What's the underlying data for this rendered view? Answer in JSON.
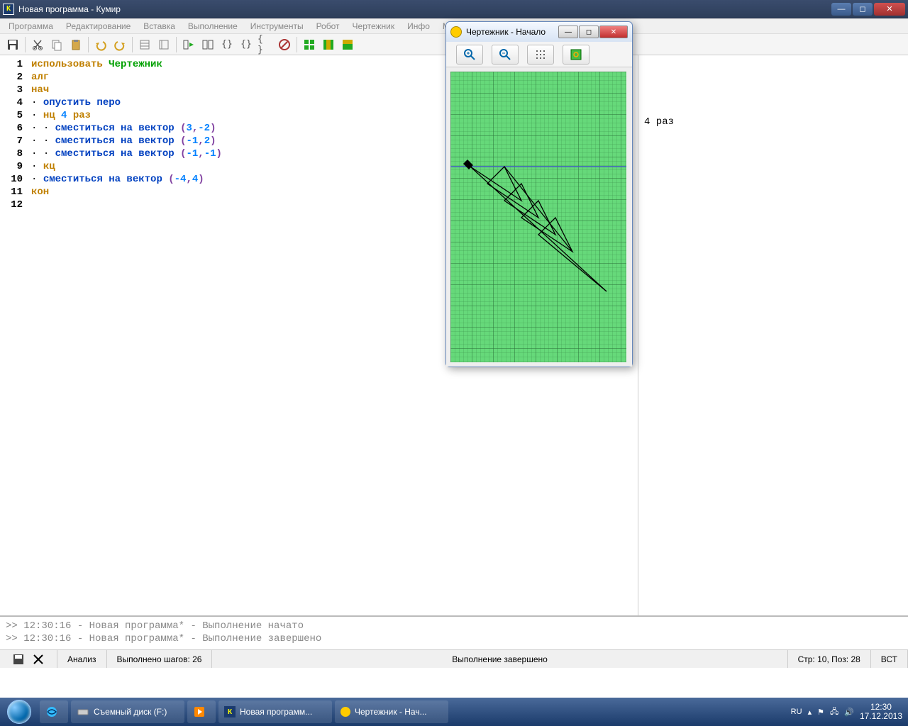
{
  "window": {
    "title": "Новая программа - Кумир",
    "icon_letter": "К"
  },
  "menu": [
    "Программа",
    "Редактирование",
    "Вставка",
    "Выполнение",
    "Инструменты",
    "Робот",
    "Чертежник",
    "Инфо",
    "Миры"
  ],
  "code": {
    "lines": [
      {
        "n": 1,
        "t": "use",
        "kw": "использовать",
        "name": "Чертежник"
      },
      {
        "n": 2,
        "t": "plain",
        "kw": "алг"
      },
      {
        "n": 3,
        "t": "plain",
        "kw": "нач"
      },
      {
        "n": 4,
        "t": "cmd",
        "indent": 1,
        "cmd": "опустить перо"
      },
      {
        "n": 5,
        "t": "loop",
        "indent": 1,
        "kw1": "нц",
        "num": "4",
        "kw2": "раз"
      },
      {
        "n": 6,
        "t": "vec",
        "indent": 2,
        "cmd": "сместиться на вектор",
        "a": "3",
        "b": "-2"
      },
      {
        "n": 7,
        "t": "vec",
        "indent": 2,
        "cmd": "сместиться на вектор",
        "a": "-1",
        "b": "2"
      },
      {
        "n": 8,
        "t": "vec",
        "indent": 2,
        "cmd": "сместиться на вектор",
        "a": "-1",
        "b": "-1"
      },
      {
        "n": 9,
        "t": "plain",
        "indent": 1,
        "kw": "кц"
      },
      {
        "n": 10,
        "t": "vec",
        "indent": 1,
        "cmd": "сместиться на вектор",
        "a": "-4",
        "b": "4"
      },
      {
        "n": 11,
        "t": "plain",
        "kw": "кон"
      },
      {
        "n": 12,
        "t": "empty"
      }
    ]
  },
  "sidepane": {
    "text": "4 раз"
  },
  "output": {
    "l1": ">> 12:30:16 - Новая программа* - Выполнение начато",
    "l2": ">> 12:30:16 - Новая программа* - Выполнение завершено"
  },
  "status": {
    "analysis": "Анализ",
    "steps": "Выполнено шагов: 26",
    "done": "Выполнение завершено",
    "pos": "Стр: 10, Поз: 28",
    "mode": "ВСТ"
  },
  "drawer": {
    "title": "Чертежник - Начало"
  },
  "taskbar": {
    "items": [
      {
        "label": "Съемный диск (F:)"
      },
      {
        "label": ""
      },
      {
        "label": "Новая программ..."
      },
      {
        "label": "Чертежник - Нач..."
      }
    ],
    "lang": "RU",
    "time": "12:30",
    "date": "17.12.2013"
  }
}
